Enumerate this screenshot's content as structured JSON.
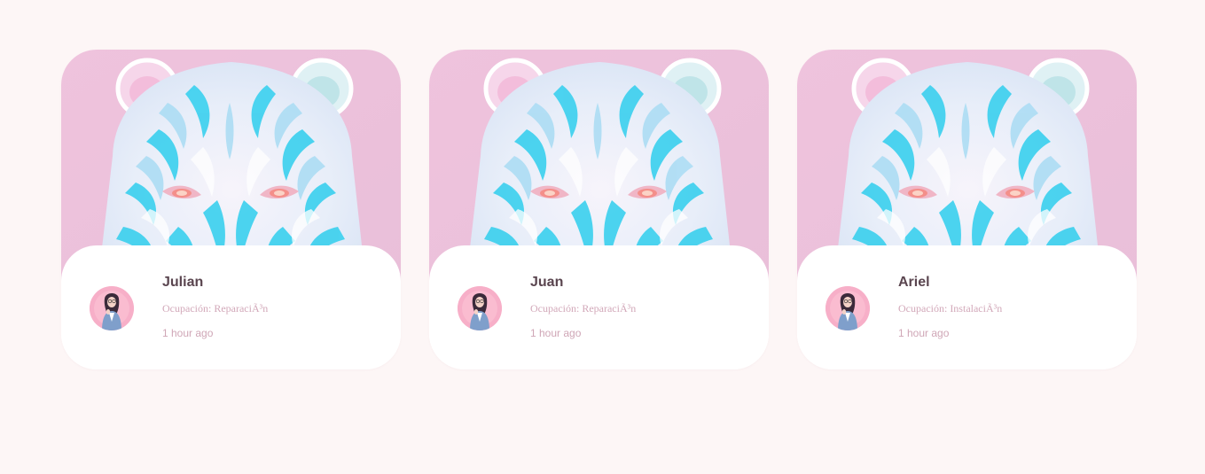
{
  "colors": {
    "page_background": "#fdf6f6",
    "card_background": "#ffffff",
    "name_text": "#5a454f",
    "meta_text": "#d2a8b9",
    "art_background": "#ecc0dc"
  },
  "cards": [
    {
      "name": "Julian",
      "occupation": "Ocupación: ReparaciÃ³n",
      "time": "1 hour ago",
      "image": "pastel-tiger-illustration",
      "avatar": "user-avatar"
    },
    {
      "name": "Juan",
      "occupation": "Ocupación: ReparaciÃ³n",
      "time": "1 hour ago",
      "image": "pastel-tiger-illustration",
      "avatar": "user-avatar"
    },
    {
      "name": "Ariel",
      "occupation": "Ocupación: InstalaciÃ³n",
      "time": "1 hour ago",
      "image": "pastel-tiger-illustration",
      "avatar": "user-avatar"
    }
  ]
}
